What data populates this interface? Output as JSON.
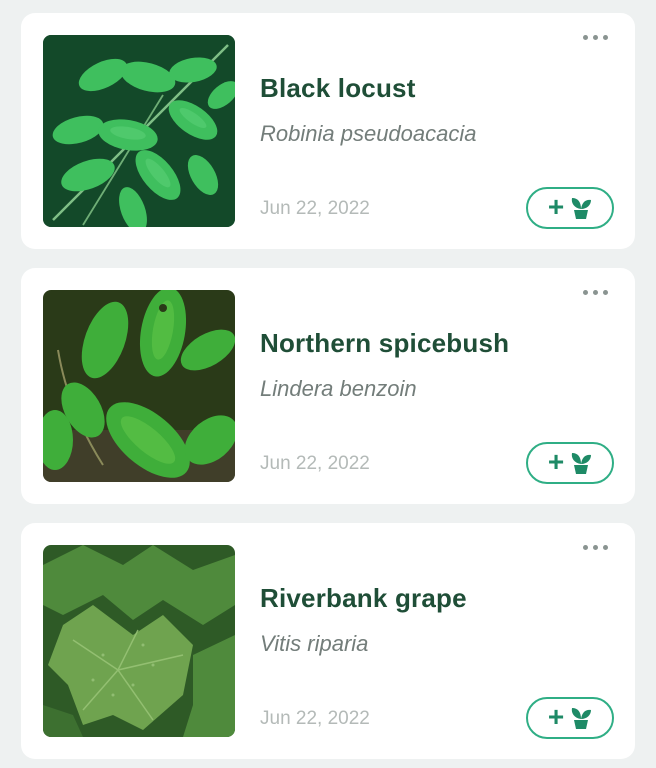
{
  "plants": [
    {
      "common_name": "Black locust",
      "scientific_name": "Robinia pseudoacacia",
      "date": "Jun 22, 2022",
      "photo_icon": "black-locust-leaf-photo"
    },
    {
      "common_name": "Northern spicebush",
      "scientific_name": "Lindera benzoin",
      "date": "Jun 22, 2022",
      "photo_icon": "spicebush-leaf-photo"
    },
    {
      "common_name": "Riverbank grape",
      "scientific_name": "Vitis riparia",
      "date": "Jun 22, 2022",
      "photo_icon": "grape-leaf-photo"
    }
  ],
  "actions": {
    "add_to_garden_symbol": "+",
    "add_to_garden_icon": "potted-plant-icon",
    "more_icon": "more-dots-icon"
  },
  "colors": {
    "accent": "#2fae85",
    "title": "#1f4e37",
    "subtitle": "#737d7a",
    "date": "#b4bab8",
    "background": "#eef1f1"
  }
}
